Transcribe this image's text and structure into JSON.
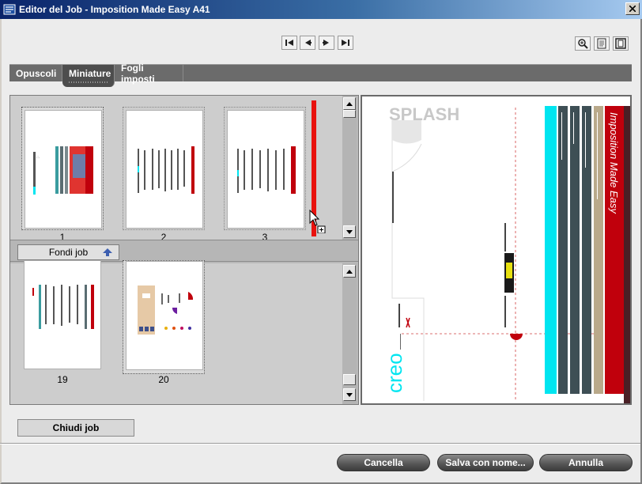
{
  "window": {
    "title": "Editor del Job  - Imposition Made Easy A41"
  },
  "navigation": {
    "first_icon": "first-page-icon",
    "prev_icon": "prev-page-icon",
    "next_icon": "next-page-icon",
    "last_icon": "last-page-icon"
  },
  "view_tools": {
    "zoom_icon": "zoom-icon",
    "page_view_icon": "page-view-icon",
    "sheet_view_icon": "sheet-view-icon"
  },
  "tabs": [
    {
      "label": "Opuscoli",
      "active": false
    },
    {
      "label": "Miniature",
      "active": true
    },
    {
      "label": "Fogli imposti",
      "active": false
    }
  ],
  "thumbnails_top": [
    {
      "number": "1",
      "selected": true
    },
    {
      "number": "2",
      "selected": false
    },
    {
      "number": "3",
      "selected": false
    }
  ],
  "fondi_job": {
    "label": "Fondi job"
  },
  "thumbnails_bottom": [
    {
      "number": "19",
      "selected": false
    },
    {
      "number": "20",
      "selected": true
    }
  ],
  "preview": {
    "vertical_title": "Imposition Made Easy",
    "brand_vertical": "creo",
    "logo_text": "SPLASH",
    "colors": {
      "cyan": "#00e5f0",
      "dark": "#3e4f55",
      "tan": "#b9a98a",
      "red": "#c0000c"
    }
  },
  "buttons": {
    "close_job": "Chiudi job",
    "cancel": "Cancella",
    "save_as": "Salva con nome...",
    "undo": "Annulla"
  },
  "colors": {
    "accent_red": "#e8120e",
    "tab_bar": "#6b6b6b"
  }
}
